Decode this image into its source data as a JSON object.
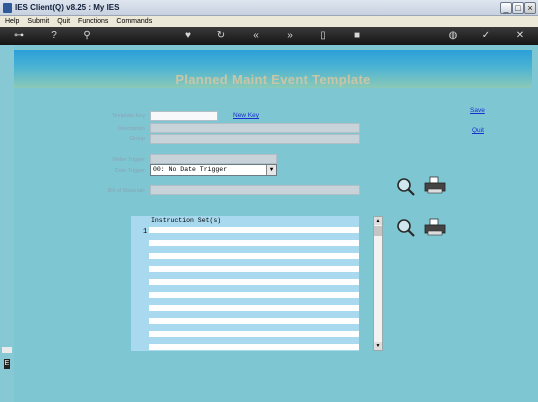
{
  "window": {
    "title": "IES Client(Q) v8.25 : My IES"
  },
  "menu": [
    "Help",
    "Submit",
    "Quit",
    "Functions",
    "Commands"
  ],
  "toolbar_icons": [
    "key-icon",
    "help-icon",
    "search-icon",
    "heart-icon",
    "refresh-icon",
    "rewind-icon",
    "forward-icon",
    "document-icon",
    "square-icon",
    "globe-icon",
    "check-icon",
    "close-icon"
  ],
  "page": {
    "title": "Planned Maint Event Template"
  },
  "form": {
    "template_key_label": "Template Key",
    "new_key_link": "New Key",
    "description_label": "Description",
    "group_label": "Group",
    "meter_trigger_label": "Meter Trigger",
    "date_trigger_label": "Date Trigger",
    "date_trigger_value": "00: No Date Trigger",
    "bill_of_materials_label": "Bill of Materials"
  },
  "actions": {
    "save": "Save",
    "quit": "Quit"
  },
  "instructions": {
    "header": "Instruction Set(s)",
    "row_number": "1"
  },
  "colors": {
    "background": "#7ec6d2",
    "banner_top": "#2b9fd8",
    "link": "#1a2fd0"
  }
}
